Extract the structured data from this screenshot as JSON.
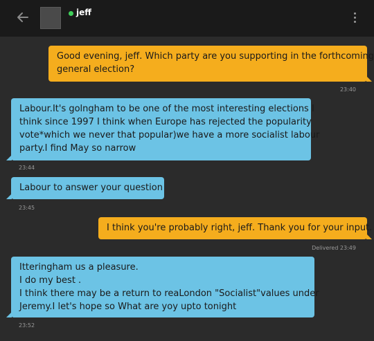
{
  "header": {
    "contact_name": "jeff",
    "online_color": "#3fcf5a",
    "back_icon": "arrow-left-icon",
    "menu_icon": "more-vertical-icon"
  },
  "messages": [
    {
      "direction": "out",
      "lines": [
        "Good evening, jeff. Which party are you supporting in the forthcoming",
        "general election?"
      ],
      "meta": "23:40"
    },
    {
      "direction": "in",
      "lines": [
        "Labour.It's golngham to be one of the most interesting elections I",
        "think since 1997 I think when Europe has rejected the popularity",
        "vote*which we never that popular)we have a more socialist labour",
        "party.I find May so narrow"
      ],
      "meta": "23:44"
    },
    {
      "direction": "in",
      "lines": [
        "Labour to answer your question"
      ],
      "meta": "23:45"
    },
    {
      "direction": "out",
      "lines": [
        "I think you're probably right, jeff. Thank you for your input."
      ],
      "meta": "Delivered 23:49"
    },
    {
      "direction": "in",
      "lines": [
        "Itteringham us a pleasure.",
        "I do my best .",
        "I think there may be a return to reaLondon \"Socialist\"values under",
        "Jeremy.I let's hope so What are yoy upto tonight"
      ],
      "meta": "23:52"
    }
  ]
}
